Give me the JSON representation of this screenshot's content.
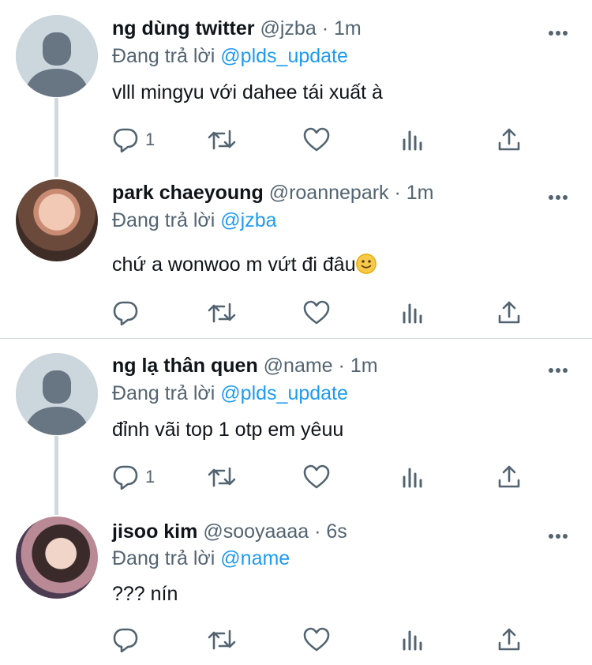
{
  "tweets": [
    {
      "name": "ng dùng twitter",
      "handle": "@jzba",
      "dot": "·",
      "time": "1m",
      "reply_prefix": "Đang trả lời",
      "reply_to": "@plds_update",
      "text": "vlll mingyu với dahee tái xuất à",
      "reply_count": "1",
      "avatar": "default-avatar"
    },
    {
      "name": "park chaeyoung",
      "handle": "@roannepark",
      "dot": "·",
      "time": "1m",
      "reply_prefix": "Đang trả lời",
      "reply_to": "@jzba",
      "text": "chứ a wonwoo m vứt đi đâu",
      "emoji": "slightly-smiling-face-emoji",
      "reply_count": "",
      "avatar": "profile-photo"
    },
    {
      "name": "ng lạ thân quen",
      "handle": "@name",
      "dot": "·",
      "time": "1m",
      "reply_prefix": "Đang trả lời",
      "reply_to": "@plds_update",
      "text": "đỉnh vãi top 1 otp em yêuu",
      "reply_count": "1",
      "avatar": "default-avatar"
    },
    {
      "name": "jisoo kim",
      "handle": "@sooyaaaa",
      "dot": "·",
      "time": "6s",
      "reply_prefix": "Đang trả lời",
      "reply_to": "@name",
      "text": "??? nín",
      "reply_count": "",
      "avatar": "profile-photo"
    }
  ],
  "colors": {
    "accent": "#1d9bf0",
    "secondary_text": "#536471",
    "thread_line": "#cfd9de",
    "default_avatar_bg": "#ccd6dd",
    "default_avatar_fg": "#687684"
  },
  "icons": [
    "comment-icon",
    "retweet-icon",
    "like-icon",
    "analytics-icon",
    "share-icon",
    "more-icon"
  ]
}
